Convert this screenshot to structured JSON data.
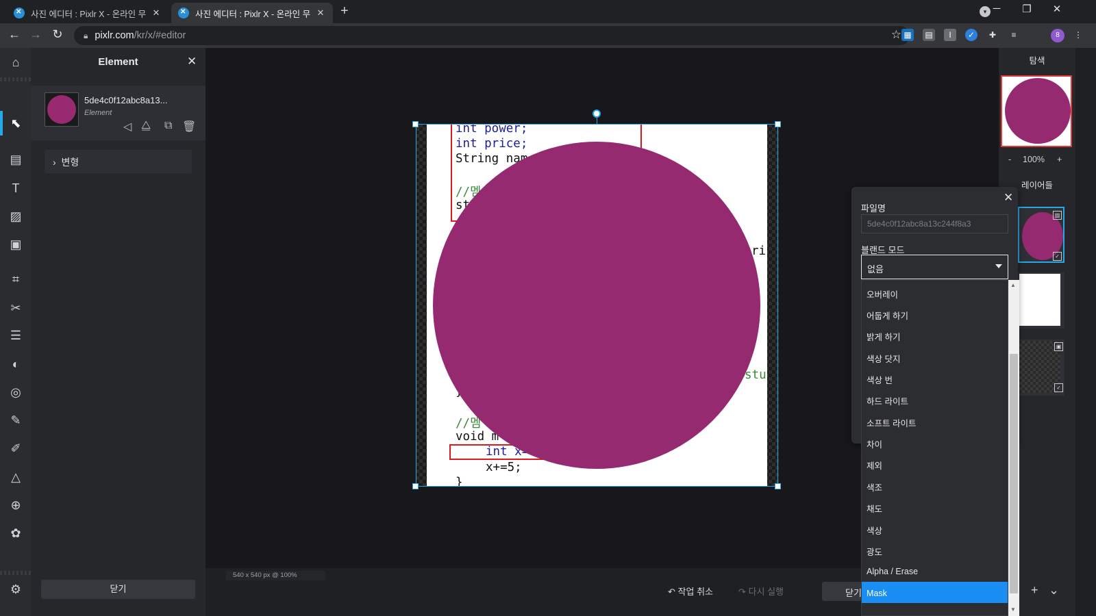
{
  "browser": {
    "tabs": [
      {
        "title": "사진 에디터 : Pixlr X - 온라인 무",
        "active": false
      },
      {
        "title": "사진 에디터 : Pixlr X - 온라인 무",
        "active": true
      }
    ],
    "url_host": "pixlr.com",
    "url_path": "/kr/x/#editor",
    "avatar_letter": "8"
  },
  "left_panel": {
    "title": "Element",
    "element_name": "5de4c0f12abc8a13...",
    "element_type": "Element",
    "transform_label": "변형",
    "close_button": "닫기"
  },
  "canvas": {
    "code_lines": [
      {
        "text": "int power;",
        "style": "kw"
      },
      {
        "text": "int price;",
        "style": "kw"
      },
      {
        "text": "String nam",
        "style": "pl"
      },
      {
        "text": "//멤",
        "style": "cm"
      },
      {
        "text": "st",
        "style": "pl"
      },
      {
        "text": "ri",
        "style": "pl"
      },
      {
        "text": "stu",
        "style": "cm"
      },
      {
        "text": "}",
        "style": "pl"
      },
      {
        "text": "//멤",
        "style": "cm"
      },
      {
        "text": "void m",
        "style": "pl"
      },
      {
        "text": "int x=",
        "style": "kw"
      },
      {
        "text": "x+=5;",
        "style": "pl"
      },
      {
        "text": "}",
        "style": "pl"
      }
    ],
    "element_color": "#962a70"
  },
  "status": {
    "info": "540 x 540 px @ 100%",
    "undo": "작업 취소",
    "redo": "다시 실행",
    "close": "닫기"
  },
  "right_panel": {
    "navigator_title": "탐색",
    "zoom_minus": "-",
    "zoom_value": "100%",
    "zoom_plus": "+",
    "layers_title": "레이어들"
  },
  "layer_settings": {
    "filename_label": "파일명",
    "filename_value": "5de4c0f12abc8a13c244f8a3",
    "blend_label": "블랜드 모드",
    "blend_selected": "없음",
    "blend_options": [
      "오버레이",
      "어둡게 하기",
      "밝게 하기",
      "색상 닷지",
      "색상 번",
      "하드 라이트",
      "소프트 라이트",
      "차이",
      "제외",
      "색조",
      "채도",
      "색상",
      "광도",
      "Alpha / Erase",
      "Mask"
    ],
    "highlighted_option": "Mask"
  },
  "colors": {
    "accent": "#28a8ea",
    "highlight": "#1a8ef2",
    "element": "#962a70"
  }
}
